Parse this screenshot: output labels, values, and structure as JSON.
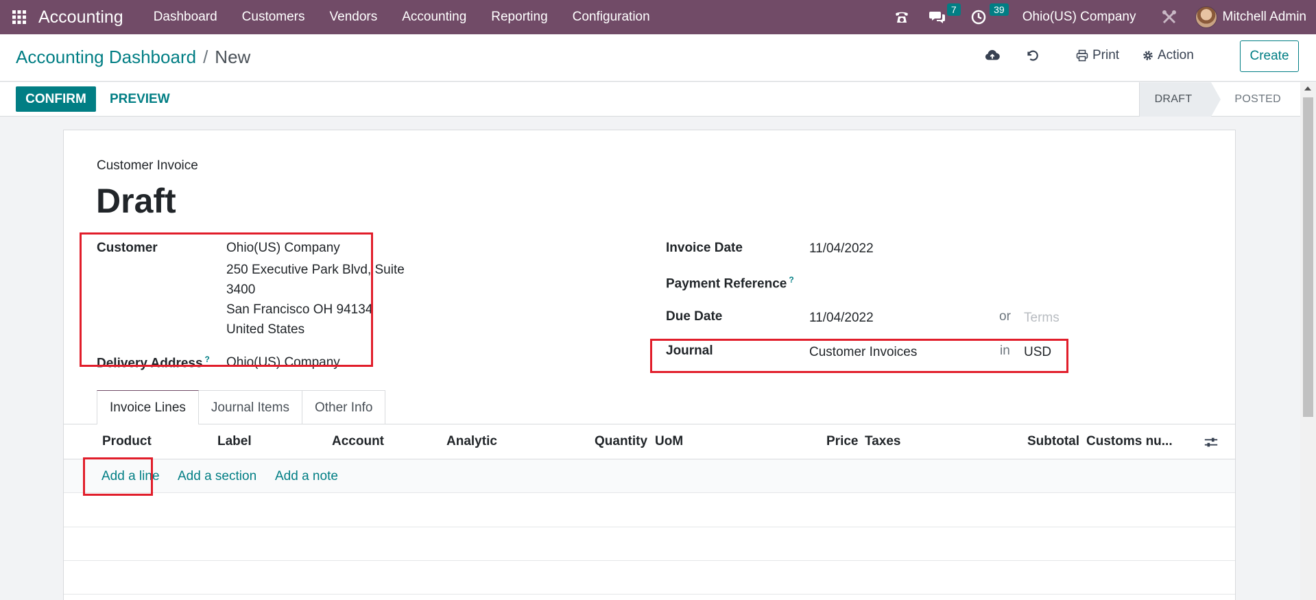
{
  "navbar": {
    "app_name": "Accounting",
    "menu": [
      "Dashboard",
      "Customers",
      "Vendors",
      "Accounting",
      "Reporting",
      "Configuration"
    ],
    "messages_count": "7",
    "activities_count": "39",
    "company": "Ohio(US) Company",
    "user": "Mitchell Admin"
  },
  "control_panel": {
    "breadcrumb_parent": "Accounting Dashboard",
    "breadcrumb_separator": "/",
    "breadcrumb_current": "New",
    "print_label": "Print",
    "action_label": "Action",
    "create_label": "Create"
  },
  "statusbar": {
    "confirm_label": "CONFIRM",
    "preview_label": "PREVIEW",
    "steps": [
      "DRAFT",
      "POSTED"
    ],
    "active_step": "DRAFT"
  },
  "form": {
    "doc_type": "Customer Invoice",
    "title": "Draft",
    "customer_label": "Customer",
    "customer_name": "Ohio(US) Company",
    "customer_address": [
      "250 Executive Park Blvd, Suite",
      "3400",
      "San Francisco OH 94134",
      "United States"
    ],
    "delivery_label": "Delivery Address",
    "delivery_value": "Ohio(US) Company",
    "invoice_date_label": "Invoice Date",
    "invoice_date": "11/04/2022",
    "payment_ref_label": "Payment Reference",
    "due_date_label": "Due Date",
    "due_date": "11/04/2022",
    "or_text": "or",
    "terms_placeholder": "Terms",
    "journal_label": "Journal",
    "journal_value": "Customer Invoices",
    "in_text": "in",
    "currency": "USD",
    "help_mark": "?"
  },
  "tabs": [
    "Invoice Lines",
    "Journal Items",
    "Other Info"
  ],
  "table": {
    "columns": [
      "Product",
      "Label",
      "Account",
      "Analytic",
      "Quantity",
      "UoM",
      "Price",
      "Taxes",
      "Subtotal",
      "Customs nu..."
    ],
    "add_line": "Add a line",
    "add_section": "Add a section",
    "add_note": "Add a note"
  },
  "colors": {
    "brand": "#714B67",
    "accent": "#017e84",
    "highlight": "#e11d2a"
  }
}
